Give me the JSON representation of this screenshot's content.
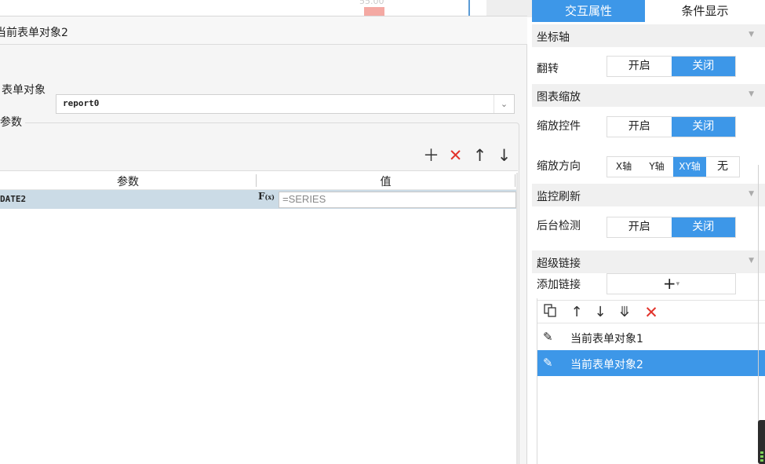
{
  "background": {
    "chart_value_label": "55.00"
  },
  "dialog": {
    "title": "当前表单对象2",
    "form_label": "表单对象",
    "form_value": "report0",
    "params_legend": "参数",
    "toolbar": {
      "add_icon": "plus-icon",
      "delete_icon": "close-icon",
      "up_icon": "arrow-up-icon",
      "down_icon": "arrow-down-icon"
    },
    "table": {
      "headers": [
        "参数",
        "值"
      ],
      "rows": [
        {
          "name": "DATE2",
          "fx": "F",
          "fx_sub": "(x)",
          "value": "=SERIES"
        }
      ]
    }
  },
  "panel": {
    "tabs": [
      "交互属性",
      "条件显示"
    ],
    "sections": {
      "axis": "坐标轴",
      "zoom": "图表缩放",
      "refresh": "监控刷新",
      "hyperlink": "超级链接"
    },
    "props": {
      "flip": {
        "label": "翻转",
        "on": "开启",
        "off": "关闭",
        "selected": "关闭"
      },
      "zoom_ctrl": {
        "label": "缩放控件",
        "on": "开启",
        "off": "关闭",
        "selected": "关闭"
      },
      "zoom_dir": {
        "label": "缩放方向",
        "options": [
          "X轴",
          "Y轴",
          "XY轴",
          "无"
        ],
        "selected": "XY轴"
      },
      "bg_check": {
        "label": "后台检测",
        "on": "开启",
        "off": "关闭",
        "selected": "关闭"
      },
      "add_link": {
        "label": "添加链接",
        "button": "+",
        "arrow": "▾"
      }
    },
    "link_items": [
      "当前表单对象1",
      "当前表单对象2"
    ],
    "selected_link": "当前表单对象2",
    "accent_color": "#3d97e8"
  }
}
